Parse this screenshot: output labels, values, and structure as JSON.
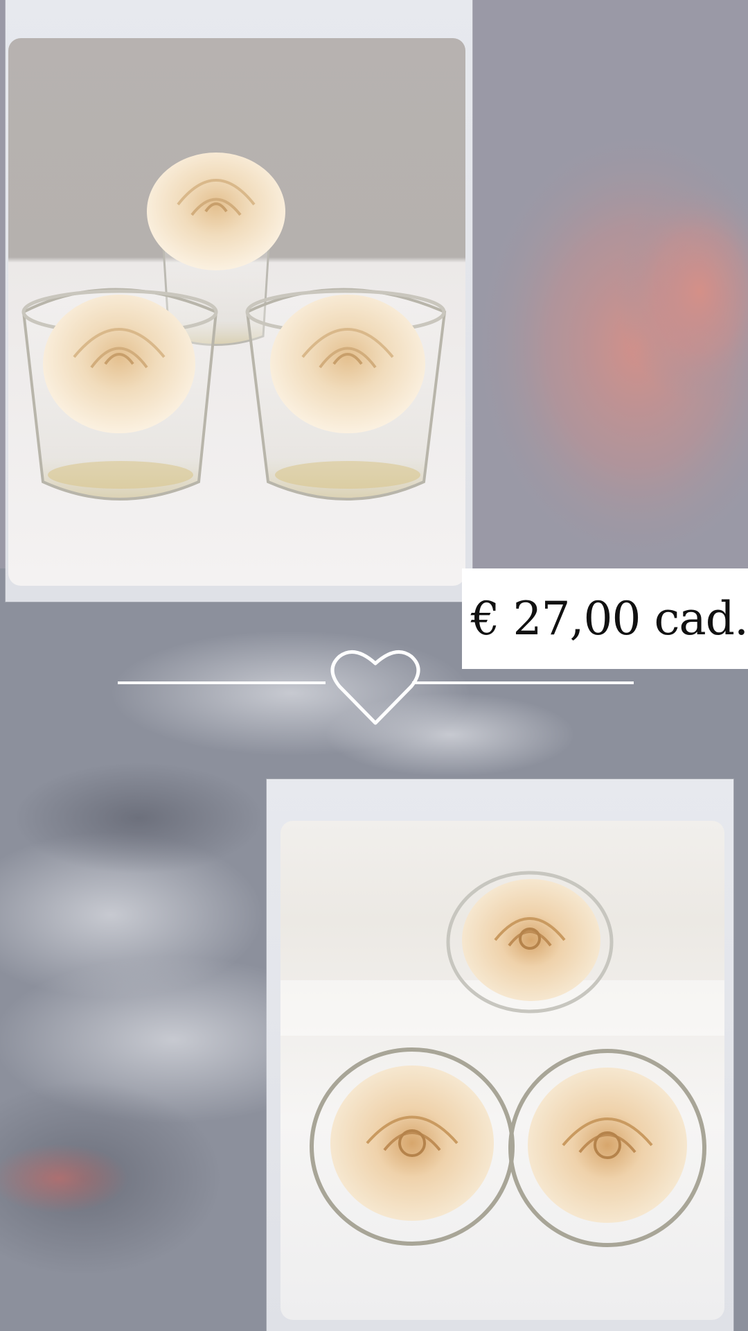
{
  "price": {
    "label": "€ 27,00 cad."
  },
  "icons": {
    "divider": "heart-outline-icon"
  },
  "colors": {
    "background_sky": "#8f93a0",
    "price_box": "#ffffff",
    "price_text": "#111111",
    "rose_cream": "#f2ddbf",
    "divider_line": "#ffffff"
  }
}
